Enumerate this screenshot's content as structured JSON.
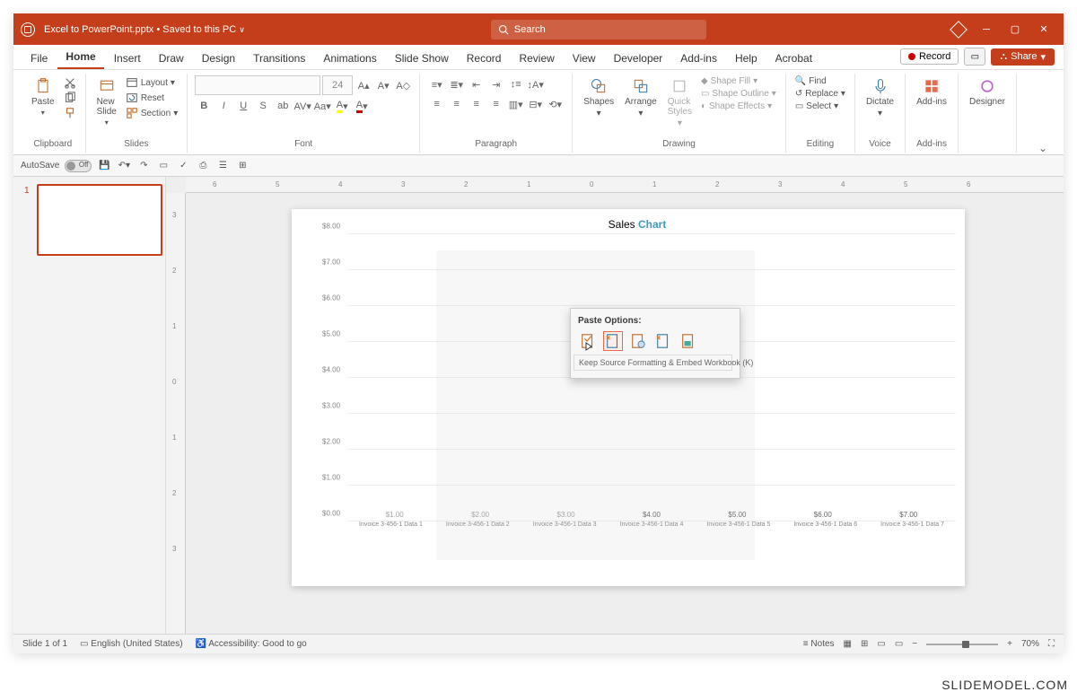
{
  "titlebar": {
    "filename": "Excel to PowerPoint.pptx",
    "save_status": "Saved to this PC",
    "search_placeholder": "Search"
  },
  "tabs": [
    "File",
    "Home",
    "Insert",
    "Draw",
    "Design",
    "Transitions",
    "Animations",
    "Slide Show",
    "Record",
    "Review",
    "View",
    "Developer",
    "Add-ins",
    "Help",
    "Acrobat"
  ],
  "active_tab": "Home",
  "record_btn": "Record",
  "share_btn": "Share",
  "ribbon": {
    "clipboard": {
      "label": "Clipboard",
      "paste": "Paste"
    },
    "slides": {
      "label": "Slides",
      "new": "New\nSlide",
      "layout": "Layout",
      "reset": "Reset",
      "section": "Section"
    },
    "font": {
      "label": "Font",
      "size": "24"
    },
    "paragraph": {
      "label": "Paragraph"
    },
    "drawing": {
      "label": "Drawing",
      "shapes": "Shapes",
      "arrange": "Arrange",
      "quick": "Quick\nStyles",
      "fill": "Shape Fill",
      "outline": "Shape Outline",
      "effects": "Shape Effects"
    },
    "editing": {
      "label": "Editing",
      "find": "Find",
      "replace": "Replace",
      "select": "Select"
    },
    "voice": {
      "label": "Voice",
      "dictate": "Dictate"
    },
    "addins": {
      "label": "Add-ins",
      "addins": "Add-ins"
    },
    "designer": {
      "label": "",
      "designer": "Designer"
    }
  },
  "autosave": "AutoSave",
  "autosave_state": "Off",
  "slide_panel": {
    "active": "1"
  },
  "ruler_marks": [
    "6",
    "5",
    "4",
    "3",
    "2",
    "1",
    "0",
    "1",
    "2",
    "3",
    "4",
    "5",
    "6"
  ],
  "paste_popup": {
    "title": "Paste Options:",
    "tooltip": "Keep Source Formatting & Embed Workbook (K)"
  },
  "chart_data": {
    "type": "bar",
    "title_prefix": "Sales ",
    "title_bold": "Chart",
    "categories": [
      "Invoice 3-456-1 Data 1",
      "Invoice 3-456-1 Data 2",
      "Invoice 3-456-1 Data 3",
      "Invoice 3-456-1 Data 4",
      "Invoice 3-456-1 Data 5",
      "Invoice 3-456-1 Data 6",
      "Invoice 3-456-1 Data 7"
    ],
    "values": [
      1.0,
      2.0,
      3.0,
      4.0,
      5.0,
      6.0,
      7.0
    ],
    "value_labels": [
      "$1.00",
      "$2.00",
      "$3.00",
      "$4.00",
      "$5.00",
      "$6.00",
      "$7.00"
    ],
    "y_ticks": [
      "$0.00",
      "$1.00",
      "$2.00",
      "$3.00",
      "$4.00",
      "$5.00",
      "$6.00",
      "$7.00",
      "$8.00"
    ],
    "ylim": [
      0,
      8
    ],
    "xlabel": "",
    "ylabel": ""
  },
  "status": {
    "slide": "Slide 1 of 1",
    "lang": "English (United States)",
    "access": "Accessibility: Good to go",
    "notes": "Notes",
    "zoom": "70%"
  },
  "watermark": "SLIDEMODEL.COM"
}
